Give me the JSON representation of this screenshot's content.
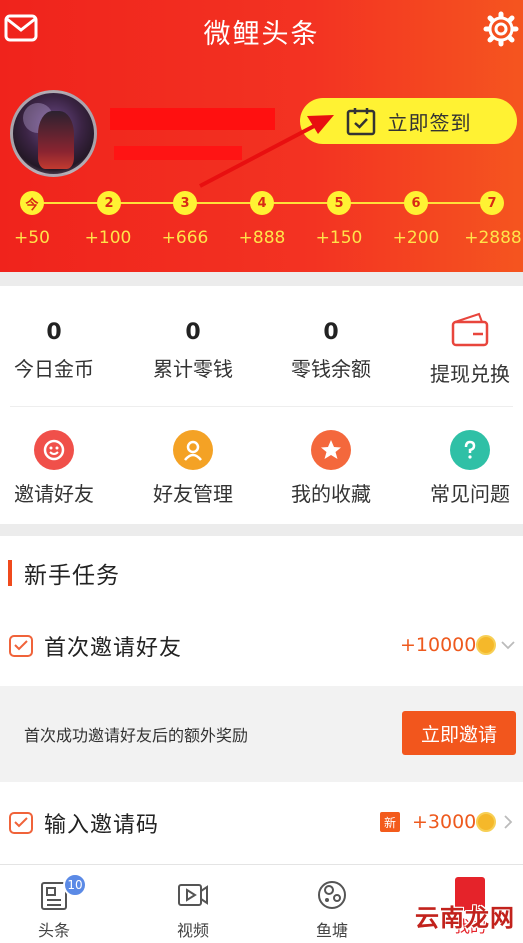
{
  "header": {
    "title": "微鲤头条",
    "signin_label": "立即签到",
    "days": [
      "今",
      "2",
      "3",
      "4",
      "5",
      "6",
      "7"
    ],
    "rewards": [
      "+50",
      "+100",
      "+666",
      "+888",
      "+150",
      "+200",
      "+2888"
    ],
    "colors": {
      "bg": "#f0231c",
      "accent": "#fff233"
    }
  },
  "stats": [
    {
      "value": "0",
      "label": "今日金币"
    },
    {
      "value": "0",
      "label": "累计零钱"
    },
    {
      "value": "0",
      "label": "零钱余额"
    },
    {
      "label": "提现兑换",
      "icon": "wallet-icon"
    }
  ],
  "shortcuts": [
    {
      "label": "邀请好友",
      "icon": "smile-icon"
    },
    {
      "label": "好友管理",
      "icon": "person-icon"
    },
    {
      "label": "我的收藏",
      "icon": "star-icon"
    },
    {
      "label": "常见问题",
      "icon": "question-icon"
    }
  ],
  "section": {
    "title": "新手任务"
  },
  "tasks": [
    {
      "title": "首次邀请好友",
      "reward": "+10000",
      "desc": "首次成功邀请好友后的额外奖励",
      "button": "立即邀请"
    },
    {
      "title": "输入邀请码",
      "reward": "+3000",
      "badge": "新"
    }
  ],
  "tabbar": {
    "items": [
      {
        "label": "头条",
        "badge": "10",
        "icon": "news-icon"
      },
      {
        "label": "视频",
        "icon": "video-icon"
      },
      {
        "label": "鱼塘",
        "icon": "fishpond-icon"
      },
      {
        "label": "我的",
        "icon": "red-packet-icon"
      }
    ],
    "watermark": "云南龙网"
  }
}
